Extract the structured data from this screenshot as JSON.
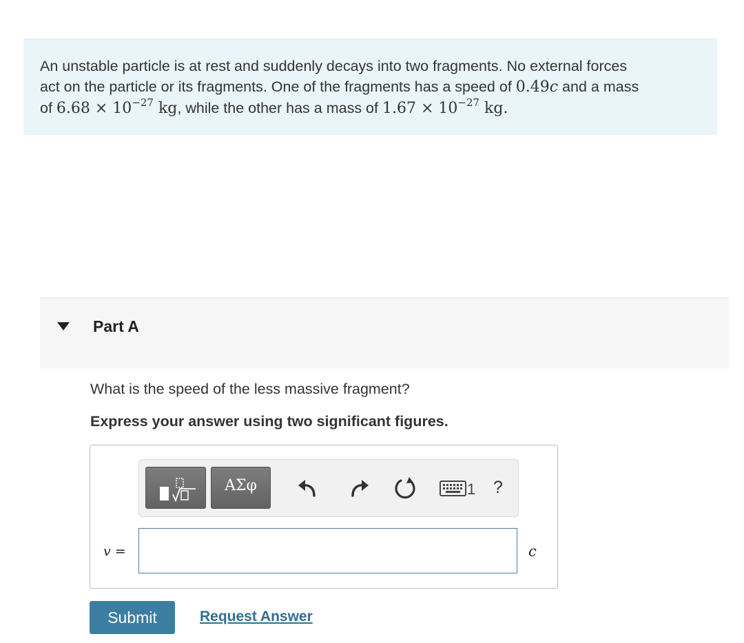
{
  "problem": {
    "line1": "An unstable particle is at rest and suddenly decays into two fragments. No external forces",
    "line2_pre": "act on the particle or its fragments. One of the fragments has a speed of ",
    "speed_value": "0.49",
    "speed_unit": "c",
    "line2_post": " and a mass",
    "line3_pre": "of ",
    "mass1_mantissa": "6.68 × 10",
    "mass1_exp": "−27",
    "mass1_unit": " kg",
    "line3_mid": ", while the other has a mass of ",
    "mass2_mantissa": "1.67 × 10",
    "mass2_exp": "−27",
    "mass2_unit": " kg",
    "line3_end": "."
  },
  "part": {
    "title": "Part A",
    "toggle_icon": "caret-down-icon"
  },
  "question": "What is the speed of the less massive fragment?",
  "instruction": "Express your answer using two significant figures.",
  "toolbar": {
    "templates_icon": "templates-sqrt-icon",
    "symbols_label": "ΑΣφ",
    "undo_icon": "undo-icon",
    "redo_icon": "redo-icon",
    "reset_icon": "reset-icon",
    "keyboard_icon": "keyboard-icon",
    "keyboard_label": "1",
    "help_label": "?"
  },
  "answer": {
    "variable": "v",
    "equals": " =",
    "value": "",
    "unit": "c"
  },
  "buttons": {
    "submit": "Submit",
    "request_answer": "Request Answer"
  }
}
